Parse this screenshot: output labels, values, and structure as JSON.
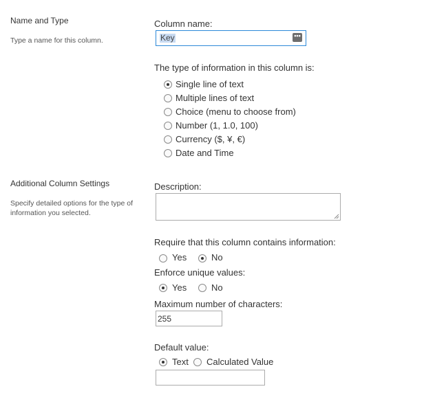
{
  "name_and_type": {
    "title": "Name and Type",
    "description": "Type a name for this column.",
    "column_name_label": "Column name:",
    "column_name_value": "Key",
    "type_label": "The type of information in this column is:",
    "types": [
      {
        "label": "Single line of text",
        "checked": true
      },
      {
        "label": "Multiple lines of text",
        "checked": false
      },
      {
        "label": "Choice (menu to choose from)",
        "checked": false
      },
      {
        "label": "Number (1, 1.0, 100)",
        "checked": false
      },
      {
        "label": "Currency ($, ¥, €)",
        "checked": false
      },
      {
        "label": "Date and Time",
        "checked": false
      }
    ]
  },
  "additional_settings": {
    "title": "Additional Column Settings",
    "description": "Specify detailed options for the type of information you selected.",
    "description_label": "Description:",
    "description_value": "",
    "require_label": "Require that this column contains information:",
    "require_yes": "Yes",
    "require_no": "No",
    "require_value": "No",
    "unique_label": "Enforce unique values:",
    "unique_yes": "Yes",
    "unique_no": "No",
    "unique_value": "Yes",
    "max_chars_label": "Maximum number of characters:",
    "max_chars_value": "255",
    "default_label": "Default value:",
    "default_text": "Text",
    "default_calculated": "Calculated Value",
    "default_selected": "Text",
    "default_value": ""
  }
}
